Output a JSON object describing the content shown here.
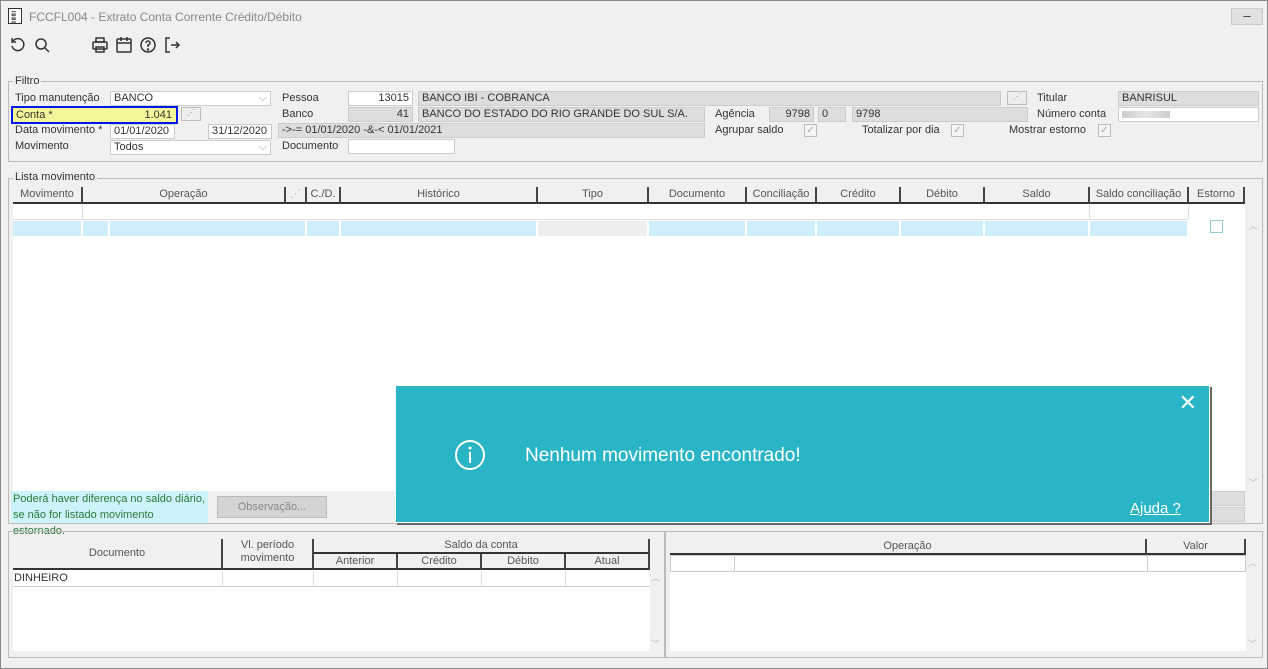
{
  "window": {
    "title": "FCCFL004 - Extrato Conta Corrente Crédito/Débito"
  },
  "toolbar": [
    "refresh-icon",
    "search-icon",
    "print-icon",
    "calendar-icon",
    "help-icon",
    "exit-icon"
  ],
  "filtro": {
    "legend": "Filtro",
    "tipo_manutencao_label": "Tipo manutenção",
    "tipo_manutencao_value": "BANCO",
    "conta_label": "Conta *",
    "conta_value": "1.041",
    "data_movimento_label": "Data movimento *",
    "data_inicio": "01/01/2020",
    "data_fim": "31/12/2020",
    "movimento_label": "Movimento",
    "movimento_value": "Todos",
    "pessoa_label": "Pessoa",
    "pessoa_code": "13015",
    "pessoa_name": "BANCO IBI - COBRANCA",
    "banco_label": "Banco",
    "banco_code": "41",
    "banco_name": "BANCO DO ESTADO DO RIO GRANDE DO SUL S/A.",
    "periodo_expr": "->-= 01/01/2020 -&-< 01/01/2021",
    "documento_label": "Documento",
    "documento_value": "",
    "agencia_label": "Agência",
    "agencia_code": "9798",
    "agencia_digit": "0",
    "agencia_name": "9798",
    "agrupar_saldo_label": "Agrupar saldo",
    "agrupar_saldo": true,
    "totalizar_label": "Totalizar por dia",
    "totalizar": true,
    "mostrar_estorno_label": "Mostrar estorno",
    "mostrar_estorno": true,
    "titular_label": "Titular",
    "titular_value": "BANRISUL",
    "numero_conta_label": "Número conta"
  },
  "lista": {
    "legend": "Lista movimento",
    "columns": [
      "Movimento",
      "Operação",
      "",
      "C./D.",
      "Histórico",
      "Tipo",
      "Documento",
      "Conciliação",
      "Crédito",
      "Débito",
      "Saldo",
      "Saldo conciliação",
      "Estorno"
    ],
    "note_line1": "Poderá haver diferença no saldo diário,",
    "note_line2": "se não for listado movimento estornado.",
    "observacao_button": "Observação..."
  },
  "resumo": {
    "col_documento": "Documento",
    "col_vl_periodo": "Vl. período movimento",
    "col_saldo": "Saldo da conta",
    "sub_anterior": "Anterior",
    "sub_credito": "Crédito",
    "sub_debito": "Débito",
    "sub_atual": "Atual",
    "row_documento": "DINHEIRO"
  },
  "operacoes": {
    "col_operacao": "Operação",
    "col_valor": "Valor"
  },
  "toast": {
    "message": "Nenhum movimento encontrado!",
    "help_link": "Ajuda ?",
    "color": "#29b5c6"
  }
}
